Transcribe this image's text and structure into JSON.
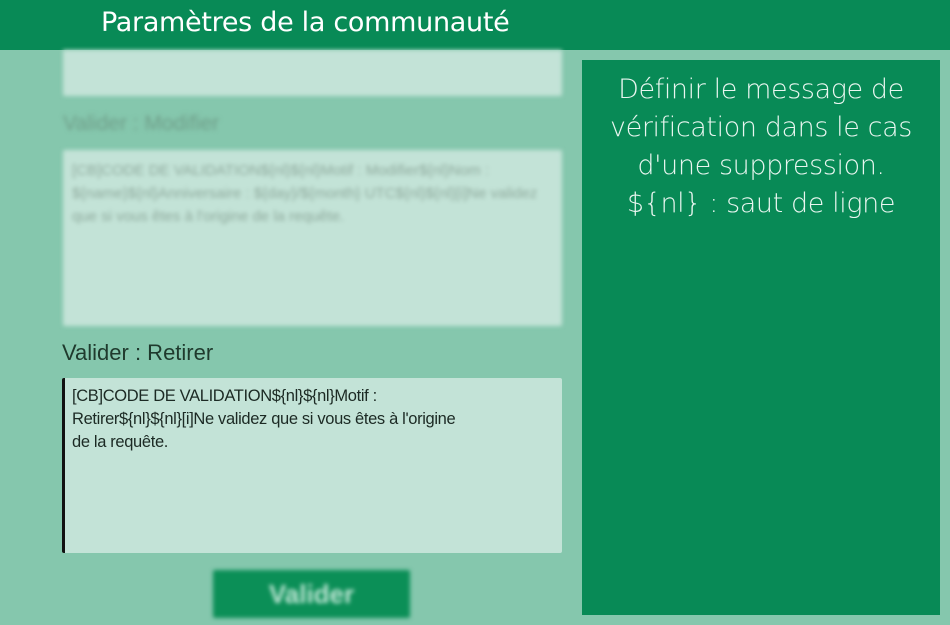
{
  "header": {
    "title": "Paramètres de la communauté"
  },
  "form": {
    "top_textarea": {
      "value": ""
    },
    "modifier": {
      "label": "Valider : Modifier",
      "value": "[CB]CODE DE VALIDATION${nl}${nl}Motif : Modifier${nl}Nom : ${name}${nl}Anniversaire : ${day}/${month} UTC${nl}${nl}[i]Ne validez que si vous êtes à l'origine de la requête."
    },
    "retirer": {
      "label": "Valider : Retirer",
      "value": "[CB]CODE DE VALIDATION${nl}${nl}Motif :\nRetirer${nl}${nl}[i]Ne validez que si vous êtes à l'origine\nde la requête."
    },
    "submit_label": "Valider"
  },
  "help": {
    "text": "Définir le message de\nvérification dans le cas\nd'une suppression.\n${nl} : saut de ligne"
  },
  "colors": {
    "primary_green": "#088a56",
    "background": "#85c7ad",
    "field_background": "#c3e3d7"
  }
}
